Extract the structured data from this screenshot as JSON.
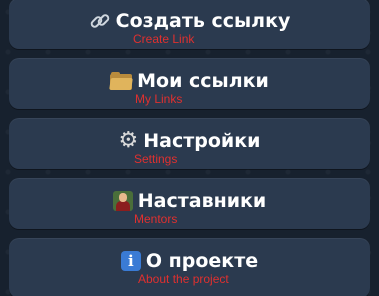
{
  "menu": {
    "buttons": [
      {
        "icon": "link-icon",
        "label": "Создать ссылку",
        "caption": "Create Link"
      },
      {
        "icon": "folder-icon",
        "label": "Мои ссылки",
        "caption": "My Links"
      },
      {
        "icon": "gear-icon",
        "label": "Настройки",
        "caption": "Settings"
      },
      {
        "icon": "teacher-icon",
        "label": "Наставники",
        "caption": "Mentors"
      },
      {
        "icon": "info-icon",
        "label": "О проекте",
        "caption": "About the project"
      }
    ]
  },
  "colors": {
    "background": "#17212e",
    "button": "#2b3a4f",
    "label": "#ffffff",
    "caption": "#e0302f"
  }
}
